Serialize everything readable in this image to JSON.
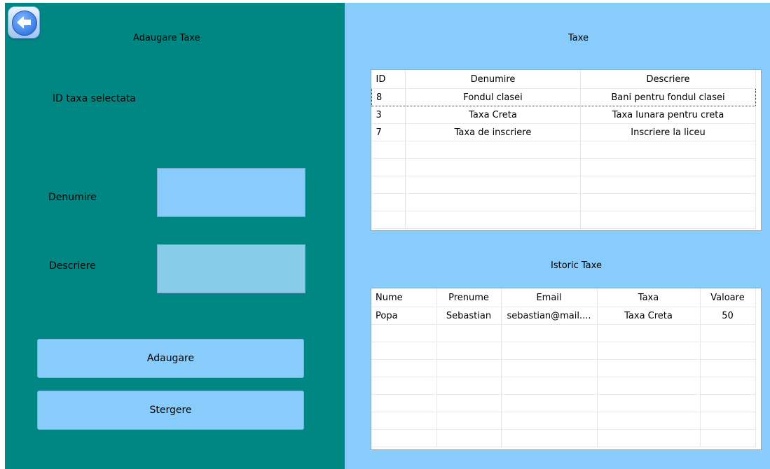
{
  "left": {
    "title": "Adaugare Taxe",
    "id_label": "ID taxa selectata",
    "denumire_label": "Denumire",
    "descriere_label": "Descriere",
    "denumire_value": "",
    "descriere_value": "",
    "add_button": "Adaugare",
    "delete_button": "Stergere"
  },
  "taxe": {
    "title": "Taxe",
    "columns": [
      "ID",
      "Denumire",
      "Descriere"
    ],
    "rows": [
      [
        "8",
        "Fondul clasei",
        "Bani pentru fondul clasei"
      ],
      [
        "3",
        "Taxa Creta",
        "Taxa lunara pentru creta"
      ],
      [
        "7",
        "Taxa de inscriere",
        "Inscriere la liceu"
      ]
    ]
  },
  "istoric": {
    "title": "Istoric Taxe",
    "columns": [
      "Nume",
      "Prenume",
      "Email",
      "Taxa",
      "Valoare"
    ],
    "rows": [
      [
        "Popa",
        "Sebastian",
        "sebastian@mail....",
        "Taxa Creta",
        "50"
      ]
    ]
  },
  "colors": {
    "left_panel": "#008783",
    "right_panel": "#87ccfa",
    "input_fill": "#87ccfa"
  }
}
